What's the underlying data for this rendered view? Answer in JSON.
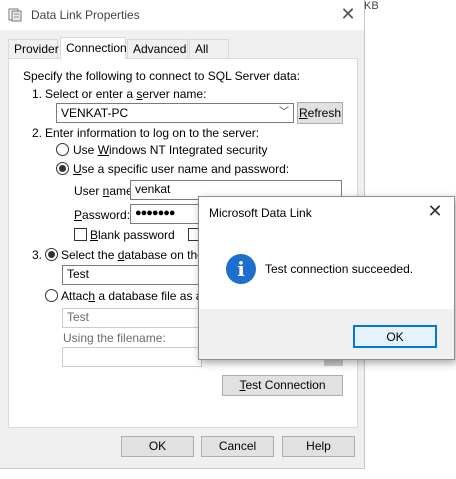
{
  "window": {
    "title": "Data Link Properties",
    "behind_text": "KB"
  },
  "tabs": [
    {
      "label": "Provider"
    },
    {
      "label": "Connection",
      "active": true
    },
    {
      "label": "Advanced"
    },
    {
      "label": "All"
    }
  ],
  "connection": {
    "intro": "Specify the following to connect to SQL Server data:",
    "step1_num": "1.",
    "step1_label": "Select or enter a server name:",
    "server_name": "VENKAT-PC",
    "refresh_button": "Refresh",
    "step2_num": "2.",
    "step2_label": "Enter information to log on to the server:",
    "windows_auth_label": "Use Windows NT Integrated security",
    "specific_user_label": "Use a specific user name and password:",
    "username_label": "User name:",
    "username_value": "venkat",
    "password_label": "Password:",
    "password_value": "●●●●●●●",
    "blank_password_label": "Blank password",
    "step3_num": "3.",
    "select_db_label": "Select the database on the server:",
    "database_value": "Test",
    "attach_db_label": "Attach a database file as a database name:",
    "attach_db_value": "Test",
    "filename_label": "Using the filename:",
    "test_connection_button": "Test Connection"
  },
  "footer": {
    "ok": "OK",
    "cancel": "Cancel",
    "help": "Help"
  },
  "message_box": {
    "title": "Microsoft Data Link",
    "icon": "info-icon",
    "message": "Test connection succeeded.",
    "ok": "OK"
  },
  "colors": {
    "info_blue": "#1c6fcc",
    "focus_blue": "#0078d7"
  }
}
